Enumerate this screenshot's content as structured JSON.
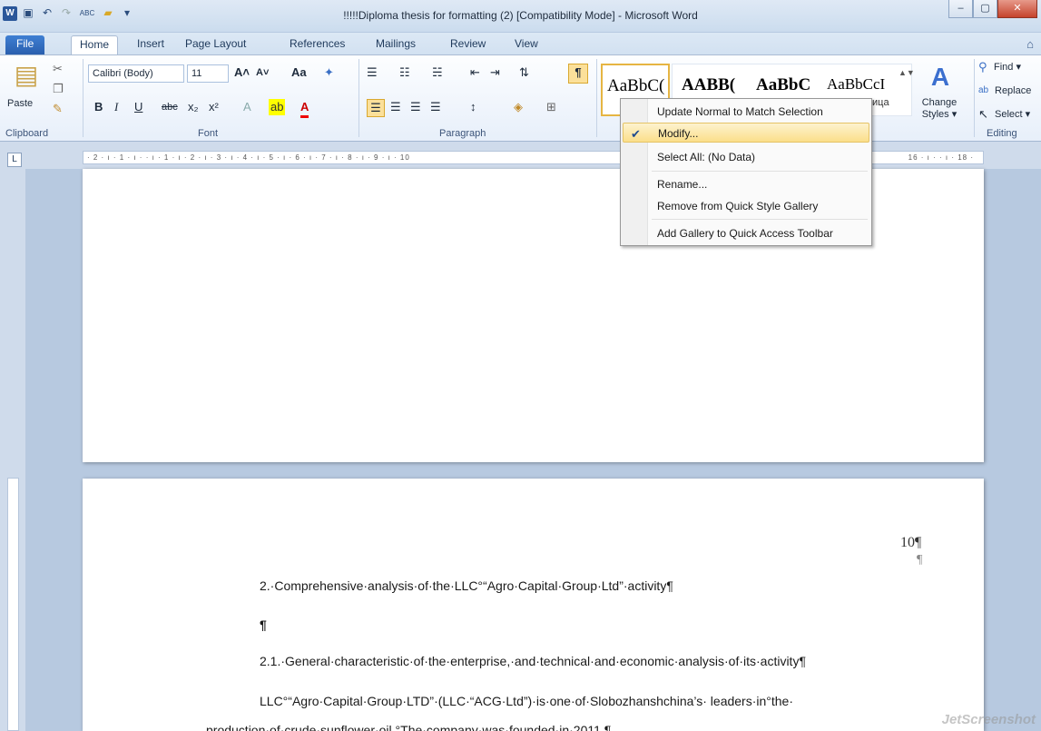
{
  "window": {
    "title": "!!!!!Diploma thesis for formatting (2) [Compatibility Mode]  -  Microsoft Word",
    "minimize": "–",
    "maximize": "▢",
    "close": "✕"
  },
  "qat": {
    "app_icon": "W",
    "save": "▣",
    "undo": "↶",
    "redo": "↷",
    "spelling": "ABC",
    "folder": "▰",
    "customize": "▾"
  },
  "tabs": {
    "file": "File",
    "home": "Home",
    "insert": "Insert",
    "page_layout": "Page Layout",
    "references": "References",
    "mailings": "Mailings",
    "review": "Review",
    "view": "View"
  },
  "ribbon": {
    "clipboard": {
      "paste": "Paste",
      "label": "Clipboard"
    },
    "font": {
      "name": "Calibri (Body)",
      "size": "11",
      "label": "Font",
      "bold": "B",
      "italic": "I",
      "underline": "U",
      "strike": "abc",
      "sub": "x₂",
      "sup": "x²",
      "grow": "A˄",
      "shrink": "A˅",
      "case": "Aa"
    },
    "paragraph": {
      "label": "Paragraph",
      "pilcrow": "¶"
    },
    "styles": {
      "samples": [
        "AaBbC(",
        "AABB(",
        "AaBbC",
        "AaBbCcI"
      ],
      "partial_name": "ица",
      "change_styles_line1": "Change",
      "change_styles_line2": "Styles ▾"
    },
    "editing": {
      "find": "Find ▾",
      "replace": "Replace",
      "select": "Select ▾",
      "label": "Editing"
    }
  },
  "ruler": {
    "left": "· 2 · ı · 1 · ı ·",
    "mid": "· ı · 1 · ı · 2 · ı · 3 · ı · 4 · ı · 5 · ı · 6 · ı · 7 · ı · 8 · ı · 9 · ı · 10",
    "right": "16 · ı ·  · ı · 18 ·"
  },
  "context_menu": {
    "items": [
      "Update Normal to Match Selection",
      "Modify...",
      "Select All: (No Data)",
      "Rename...",
      "Remove from Quick Style Gallery",
      "Add Gallery to Quick Access Toolbar"
    ]
  },
  "document": {
    "page_number": "10¶",
    "pilcrow_line": "¶",
    "heading_2": "2.·Comprehensive·analysis·of·the·LLC°“Agro·Capital·Group·Ltd”·activity¶",
    "empty_para": "¶",
    "heading_2_1": "2.1.·General·characteristic·of·the·enterprise,·and·technical·and·economic·analysis·of·its·activity¶",
    "body_line_1": "LLC°“Agro·Capital·Group·LTD”·(LLC·“ACG·Ltd”)·is·one·of·Slobozhanshchina’s· leaders·in°the·",
    "body_line_2": "production·of·crude·sunflower·oil.°The·company·was·founded·in·2011.¶"
  },
  "watermark": "JetScreenshot"
}
